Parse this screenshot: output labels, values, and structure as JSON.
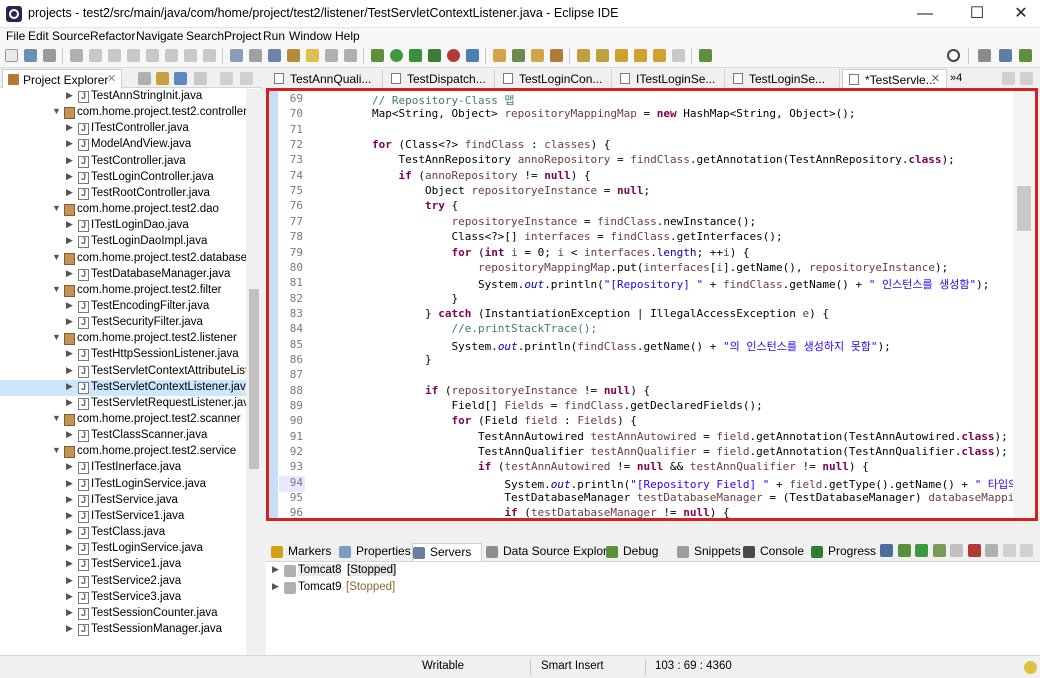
{
  "window": {
    "title": "projects - test2/src/main/java/com/home/project/test2/listener/TestServletContextListener.java - Eclipse IDE",
    "min": "—",
    "max": "☐",
    "close": "✕"
  },
  "menu": [
    "File",
    "Edit",
    "Source",
    "Refactor",
    "Navigate",
    "Search",
    "Project",
    "Run",
    "Window",
    "Help"
  ],
  "explorer": {
    "tab_label": "Project Explorer",
    "tree": [
      {
        "type": "file",
        "label": "TestAnnStringInit.java"
      },
      {
        "type": "pkg",
        "label": "com.home.project.test2.controller"
      },
      {
        "type": "file",
        "label": "ITestController.java"
      },
      {
        "type": "file",
        "label": "ModelAndView.java"
      },
      {
        "type": "file",
        "label": "TestController.java"
      },
      {
        "type": "file",
        "label": "TestLoginController.java"
      },
      {
        "type": "file",
        "label": "TestRootController.java"
      },
      {
        "type": "pkg",
        "label": "com.home.project.test2.dao"
      },
      {
        "type": "file",
        "label": "ITestLoginDao.java"
      },
      {
        "type": "file",
        "label": "TestLoginDaoImpl.java"
      },
      {
        "type": "pkg",
        "label": "com.home.project.test2.database"
      },
      {
        "type": "file",
        "label": "TestDatabaseManager.java"
      },
      {
        "type": "pkg",
        "label": "com.home.project.test2.filter"
      },
      {
        "type": "file",
        "label": "TestEncodingFilter.java"
      },
      {
        "type": "file",
        "label": "TestSecurityFilter.java"
      },
      {
        "type": "pkg",
        "label": "com.home.project.test2.listener"
      },
      {
        "type": "file",
        "label": "TestHttpSessionListener.java"
      },
      {
        "type": "file",
        "label": "TestServletContextAttributeListe"
      },
      {
        "type": "file",
        "label": "TestServletContextListener.java",
        "selected": true
      },
      {
        "type": "file",
        "label": "TestServletRequestListener.java"
      },
      {
        "type": "pkg",
        "label": "com.home.project.test2.scanner"
      },
      {
        "type": "file",
        "label": "TestClassScanner.java"
      },
      {
        "type": "pkg",
        "label": "com.home.project.test2.service"
      },
      {
        "type": "file",
        "label": "ITestInerface.java"
      },
      {
        "type": "file",
        "label": "ITestLoginService.java"
      },
      {
        "type": "file",
        "label": "ITestService.java"
      },
      {
        "type": "file",
        "label": "ITestService1.java"
      },
      {
        "type": "file",
        "label": "TestClass.java"
      },
      {
        "type": "file",
        "label": "TestLoginService.java"
      },
      {
        "type": "file",
        "label": "TestService1.java"
      },
      {
        "type": "file",
        "label": "TestService2.java"
      },
      {
        "type": "file",
        "label": "TestService3.java"
      },
      {
        "type": "file",
        "label": "TestSessionCounter.java"
      },
      {
        "type": "file",
        "label": "TestSessionManager.java"
      }
    ]
  },
  "editor_tabs": [
    {
      "label": "TestAnnQuali..."
    },
    {
      "label": "TestDispatch..."
    },
    {
      "label": "TestLoginCon..."
    },
    {
      "label": "ITestLoginSe..."
    },
    {
      "label": "TestLoginSe..."
    },
    {
      "label": "*TestServle...",
      "active": true
    }
  ],
  "editor_overflow": "»4",
  "code": [
    {
      "n": "69",
      "html": "        <span class=\"cm\">// Repository-Class 맵</span>"
    },
    {
      "n": "70",
      "html": "        Map&lt;String, Object&gt; <span class=\"lv\">repositoryMappingMap</span> = <span class=\"kw\">new</span> HashMap&lt;String, Object&gt;();"
    },
    {
      "n": "71",
      "html": ""
    },
    {
      "n": "72",
      "html": "        <span class=\"kw\">for</span> (Class&lt;?&gt; <span class=\"lv\">findClass</span> : <span class=\"lv\">classes</span>) {"
    },
    {
      "n": "73",
      "html": "            TestAnnRepository <span class=\"lv\">annoRepository</span> = <span class=\"lv\">findClass</span>.getAnnotation(TestAnnRepository.<span class=\"kw\">class</span>);"
    },
    {
      "n": "74",
      "html": "            <span class=\"kw\">if</span> (<span class=\"lv\">annoRepository</span> != <span class=\"kw\">null</span>) {"
    },
    {
      "n": "75",
      "html": "                Object <span class=\"lv\">repositoryeInstance</span> = <span class=\"kw\">null</span>;"
    },
    {
      "n": "76",
      "html": "                <span class=\"kw\">try</span> {"
    },
    {
      "n": "77",
      "html": "                    <span class=\"lv\">repositoryeInstance</span> = <span class=\"lv\">findClass</span>.newInstance();"
    },
    {
      "n": "78",
      "html": "                    Class&lt;?&gt;[] <span class=\"lv\">interfaces</span> = <span class=\"lv\">findClass</span>.getInterfaces();"
    },
    {
      "n": "79",
      "html": "                    <span class=\"kw\">for</span> (<span class=\"kw\">int</span> <span class=\"lv\">i</span> = 0; <span class=\"lv\">i</span> &lt; <span class=\"lv\">interfaces</span>.<span class=\"fd\">length</span>; ++<span class=\"lv\">i</span>) {"
    },
    {
      "n": "80",
      "html": "                        <span class=\"lv\">repositoryMappingMap</span>.put(<span class=\"lv\">interfaces</span>[<span class=\"lv\">i</span>].getName(), <span class=\"lv\">repositoryeInstance</span>);"
    },
    {
      "n": "81",
      "html": "                        System.<span class=\"fd it\">out</span>.println(<span class=\"st\">\"[Repository] \"</span> + <span class=\"lv\">findClass</span>.getName() + <span class=\"st\">\" 인스턴스를 생성함\"</span>);"
    },
    {
      "n": "82",
      "html": "                    }"
    },
    {
      "n": "83",
      "html": "                } <span class=\"kw\">catch</span> (InstantiationException | IllegalAccessException <span class=\"lv\">e</span>) {"
    },
    {
      "n": "84",
      "html": "                    <span class=\"cm\">//e.printStackTrace();</span>"
    },
    {
      "n": "85",
      "html": "                    System.<span class=\"fd it\">out</span>.println(<span class=\"lv\">findClass</span>.getName() + <span class=\"st\">\"의 인스턴스를 생성하지 못함\"</span>);"
    },
    {
      "n": "86",
      "html": "                }"
    },
    {
      "n": "87",
      "html": ""
    },
    {
      "n": "88",
      "html": "                <span class=\"kw\">if</span> (<span class=\"lv\">repositoryeInstance</span> != <span class=\"kw\">null</span>) {"
    },
    {
      "n": "89",
      "html": "                    Field[] <span class=\"lv\">Fields</span> = <span class=\"lv\">findClass</span>.getDeclaredFields();"
    },
    {
      "n": "90",
      "html": "                    <span class=\"kw\">for</span> (Field <span class=\"lv\">field</span> : <span class=\"lv\">Fields</span>) {"
    },
    {
      "n": "91",
      "html": "                        TestAnnAutowired <span class=\"lv\">testAnnAutowired</span> = <span class=\"lv\">field</span>.getAnnotation(TestAnnAutowired.<span class=\"kw\">class</span>);"
    },
    {
      "n": "92",
      "html": "                        TestAnnQualifier <span class=\"lv\">testAnnQualifier</span> = <span class=\"lv\">field</span>.getAnnotation(TestAnnQualifier.<span class=\"kw\">class</span>);"
    },
    {
      "n": "93",
      "html": "                        <span class=\"kw\">if</span> (<span class=\"lv\">testAnnAutowired</span> != <span class=\"kw\">null</span> &amp;&amp; <span class=\"lv\">testAnnQualifier</span> != <span class=\"kw\">null</span>) {"
    },
    {
      "n": "94",
      "html": "                            System.<span class=\"fd it\">out</span>.println(<span class=\"st\">\"[Repository Field] \"</span> + <span class=\"lv\">field</span>.getType().getName() + <span class=\"st\">\" 타입의</span>"
    },
    {
      "n": "95",
      "html": "                            TestDatabaseManager <span class=\"lv\">testDatabaseManager</span> = (TestDatabaseManager) <span class=\"lv\">databaseMappi</span>"
    },
    {
      "n": "96",
      "html": "                            <span class=\"kw\">if</span> (<span class=\"lv\">testDatabaseManager</span> != <span class=\"kw\">null</span>) {"
    }
  ],
  "bottom_tabs": [
    {
      "label": "Markers",
      "color": "#d4a017"
    },
    {
      "label": "Properties",
      "color": "#7a9fc7"
    },
    {
      "label": "Servers",
      "color": "#6b7fa3",
      "active": true
    },
    {
      "label": "Data Source Explorer",
      "color": "#8c8c8c"
    },
    {
      "label": "Debug",
      "color": "#5a8f3c"
    },
    {
      "label": "Snippets",
      "color": "#9c9c9c"
    },
    {
      "label": "Console",
      "color": "#4a4a4a"
    },
    {
      "label": "Progress",
      "color": "#2e7d32"
    }
  ],
  "servers": [
    {
      "name": "Tomcat8",
      "status": "[Stopped]",
      "selected": true
    },
    {
      "name": "Tomcat9",
      "status": "[Stopped]"
    }
  ],
  "status": {
    "writable": "Writable",
    "insert": "Smart Insert",
    "position": "103 : 69 : 4360"
  }
}
